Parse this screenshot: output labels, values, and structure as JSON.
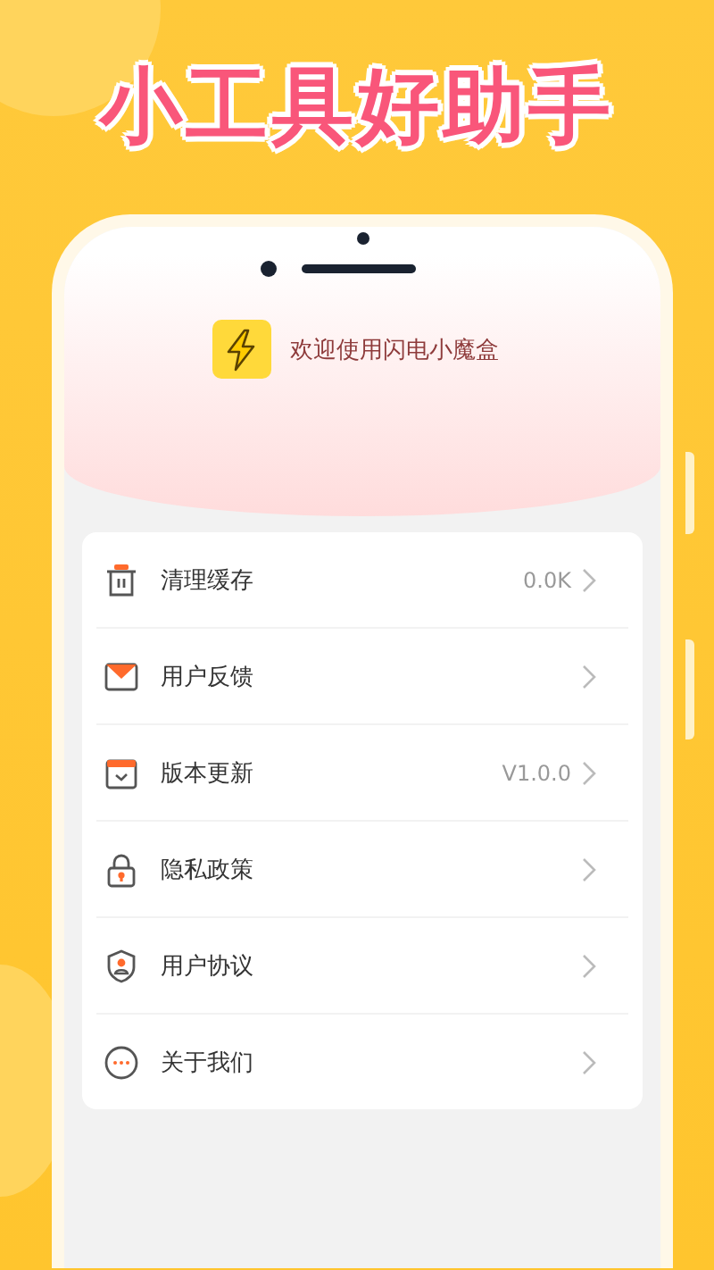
{
  "headline": "小工具好助手",
  "app": {
    "welcome": "欢迎使用闪电小魔盒"
  },
  "menu": [
    {
      "label": "清理缓存",
      "value": "0.0K"
    },
    {
      "label": "用户反馈"
    },
    {
      "label": "版本更新",
      "value": "V1.0.0"
    },
    {
      "label": "隐私政策"
    },
    {
      "label": "用户协议"
    },
    {
      "label": "关于我们"
    }
  ]
}
